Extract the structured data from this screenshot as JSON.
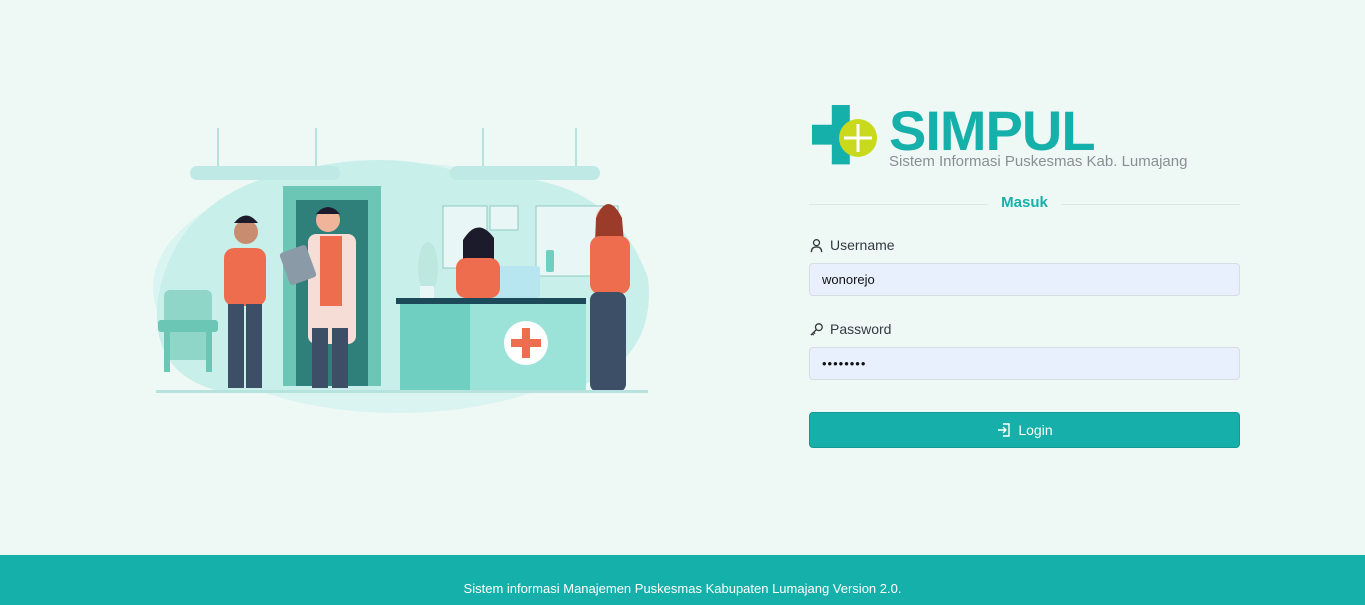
{
  "brand": {
    "name": "SIMPUL",
    "subtitle": "Sistem Informasi Puskesmas Kab. Lumajang"
  },
  "login": {
    "title": "Masuk",
    "username_label": "Username",
    "username_value": "wonorejo",
    "password_label": "Password",
    "password_value": "••••••••",
    "button_label": "Login"
  },
  "footer": {
    "text": "Sistem informasi Manajemen Puskesmas Kabupaten Lumajang Version 2.0."
  },
  "icons": {
    "username": "user-icon",
    "password": "key-icon",
    "login": "login-icon"
  },
  "colors": {
    "accent": "#16b0aa",
    "background": "#eef8f5",
    "input_bg": "#e8f0fe"
  }
}
